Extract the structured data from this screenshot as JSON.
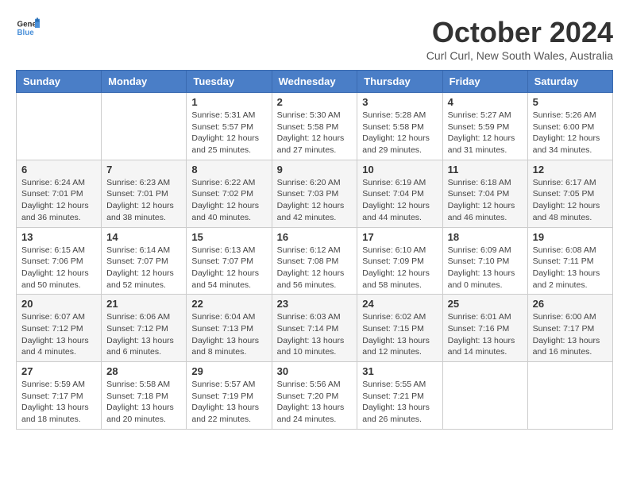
{
  "logo": {
    "text_general": "General",
    "text_blue": "Blue"
  },
  "title": "October 2024",
  "location": "Curl Curl, New South Wales, Australia",
  "days_of_week": [
    "Sunday",
    "Monday",
    "Tuesday",
    "Wednesday",
    "Thursday",
    "Friday",
    "Saturday"
  ],
  "weeks": [
    [
      {
        "day": "",
        "info": ""
      },
      {
        "day": "",
        "info": ""
      },
      {
        "day": "1",
        "sunrise": "Sunrise: 5:31 AM",
        "sunset": "Sunset: 5:57 PM",
        "daylight": "Daylight: 12 hours and 25 minutes."
      },
      {
        "day": "2",
        "sunrise": "Sunrise: 5:30 AM",
        "sunset": "Sunset: 5:58 PM",
        "daylight": "Daylight: 12 hours and 27 minutes."
      },
      {
        "day": "3",
        "sunrise": "Sunrise: 5:28 AM",
        "sunset": "Sunset: 5:58 PM",
        "daylight": "Daylight: 12 hours and 29 minutes."
      },
      {
        "day": "4",
        "sunrise": "Sunrise: 5:27 AM",
        "sunset": "Sunset: 5:59 PM",
        "daylight": "Daylight: 12 hours and 31 minutes."
      },
      {
        "day": "5",
        "sunrise": "Sunrise: 5:26 AM",
        "sunset": "Sunset: 6:00 PM",
        "daylight": "Daylight: 12 hours and 34 minutes."
      }
    ],
    [
      {
        "day": "6",
        "sunrise": "Sunrise: 6:24 AM",
        "sunset": "Sunset: 7:01 PM",
        "daylight": "Daylight: 12 hours and 36 minutes."
      },
      {
        "day": "7",
        "sunrise": "Sunrise: 6:23 AM",
        "sunset": "Sunset: 7:01 PM",
        "daylight": "Daylight: 12 hours and 38 minutes."
      },
      {
        "day": "8",
        "sunrise": "Sunrise: 6:22 AM",
        "sunset": "Sunset: 7:02 PM",
        "daylight": "Daylight: 12 hours and 40 minutes."
      },
      {
        "day": "9",
        "sunrise": "Sunrise: 6:20 AM",
        "sunset": "Sunset: 7:03 PM",
        "daylight": "Daylight: 12 hours and 42 minutes."
      },
      {
        "day": "10",
        "sunrise": "Sunrise: 6:19 AM",
        "sunset": "Sunset: 7:04 PM",
        "daylight": "Daylight: 12 hours and 44 minutes."
      },
      {
        "day": "11",
        "sunrise": "Sunrise: 6:18 AM",
        "sunset": "Sunset: 7:04 PM",
        "daylight": "Daylight: 12 hours and 46 minutes."
      },
      {
        "day": "12",
        "sunrise": "Sunrise: 6:17 AM",
        "sunset": "Sunset: 7:05 PM",
        "daylight": "Daylight: 12 hours and 48 minutes."
      }
    ],
    [
      {
        "day": "13",
        "sunrise": "Sunrise: 6:15 AM",
        "sunset": "Sunset: 7:06 PM",
        "daylight": "Daylight: 12 hours and 50 minutes."
      },
      {
        "day": "14",
        "sunrise": "Sunrise: 6:14 AM",
        "sunset": "Sunset: 7:07 PM",
        "daylight": "Daylight: 12 hours and 52 minutes."
      },
      {
        "day": "15",
        "sunrise": "Sunrise: 6:13 AM",
        "sunset": "Sunset: 7:07 PM",
        "daylight": "Daylight: 12 hours and 54 minutes."
      },
      {
        "day": "16",
        "sunrise": "Sunrise: 6:12 AM",
        "sunset": "Sunset: 7:08 PM",
        "daylight": "Daylight: 12 hours and 56 minutes."
      },
      {
        "day": "17",
        "sunrise": "Sunrise: 6:10 AM",
        "sunset": "Sunset: 7:09 PM",
        "daylight": "Daylight: 12 hours and 58 minutes."
      },
      {
        "day": "18",
        "sunrise": "Sunrise: 6:09 AM",
        "sunset": "Sunset: 7:10 PM",
        "daylight": "Daylight: 13 hours and 0 minutes."
      },
      {
        "day": "19",
        "sunrise": "Sunrise: 6:08 AM",
        "sunset": "Sunset: 7:11 PM",
        "daylight": "Daylight: 13 hours and 2 minutes."
      }
    ],
    [
      {
        "day": "20",
        "sunrise": "Sunrise: 6:07 AM",
        "sunset": "Sunset: 7:12 PM",
        "daylight": "Daylight: 13 hours and 4 minutes."
      },
      {
        "day": "21",
        "sunrise": "Sunrise: 6:06 AM",
        "sunset": "Sunset: 7:12 PM",
        "daylight": "Daylight: 13 hours and 6 minutes."
      },
      {
        "day": "22",
        "sunrise": "Sunrise: 6:04 AM",
        "sunset": "Sunset: 7:13 PM",
        "daylight": "Daylight: 13 hours and 8 minutes."
      },
      {
        "day": "23",
        "sunrise": "Sunrise: 6:03 AM",
        "sunset": "Sunset: 7:14 PM",
        "daylight": "Daylight: 13 hours and 10 minutes."
      },
      {
        "day": "24",
        "sunrise": "Sunrise: 6:02 AM",
        "sunset": "Sunset: 7:15 PM",
        "daylight": "Daylight: 13 hours and 12 minutes."
      },
      {
        "day": "25",
        "sunrise": "Sunrise: 6:01 AM",
        "sunset": "Sunset: 7:16 PM",
        "daylight": "Daylight: 13 hours and 14 minutes."
      },
      {
        "day": "26",
        "sunrise": "Sunrise: 6:00 AM",
        "sunset": "Sunset: 7:17 PM",
        "daylight": "Daylight: 13 hours and 16 minutes."
      }
    ],
    [
      {
        "day": "27",
        "sunrise": "Sunrise: 5:59 AM",
        "sunset": "Sunset: 7:17 PM",
        "daylight": "Daylight: 13 hours and 18 minutes."
      },
      {
        "day": "28",
        "sunrise": "Sunrise: 5:58 AM",
        "sunset": "Sunset: 7:18 PM",
        "daylight": "Daylight: 13 hours and 20 minutes."
      },
      {
        "day": "29",
        "sunrise": "Sunrise: 5:57 AM",
        "sunset": "Sunset: 7:19 PM",
        "daylight": "Daylight: 13 hours and 22 minutes."
      },
      {
        "day": "30",
        "sunrise": "Sunrise: 5:56 AM",
        "sunset": "Sunset: 7:20 PM",
        "daylight": "Daylight: 13 hours and 24 minutes."
      },
      {
        "day": "31",
        "sunrise": "Sunrise: 5:55 AM",
        "sunset": "Sunset: 7:21 PM",
        "daylight": "Daylight: 13 hours and 26 minutes."
      },
      {
        "day": "",
        "info": ""
      },
      {
        "day": "",
        "info": ""
      }
    ]
  ],
  "row_shading": [
    false,
    true,
    false,
    true,
    false
  ]
}
